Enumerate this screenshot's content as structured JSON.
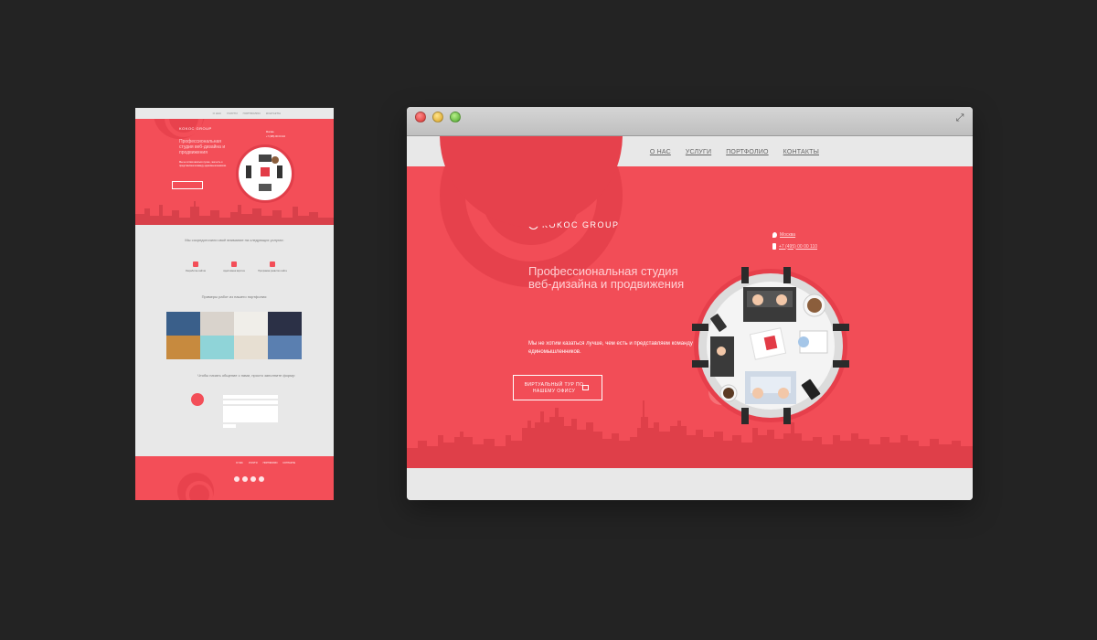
{
  "theme": {
    "accent": "#f24d57",
    "accent_dark": "#e6414c",
    "background": "#232323",
    "site_gray": "#e8e8e8"
  },
  "browser": {
    "window_buttons": [
      "close-icon",
      "minimize-icon",
      "zoom-icon"
    ],
    "fullscreen_icon": "fullscreen-icon"
  },
  "site": {
    "nav": [
      "О НАС",
      "УСЛУГИ",
      "ПОРТФОЛИО",
      "КОНТАКТЫ"
    ],
    "logo_mark": "K",
    "logo_text": "KOKOC GROUP",
    "headline": "Профессиональная студия веб-дизайна и продвижения",
    "subtext": "Мы не хотим казаться лучше, чем есть и представляем команду единомышленников.",
    "cta": "ВИРТУАЛЬНЫЙ ТУР ПО НАШЕМУ ОФИСУ",
    "city": "Москва",
    "phone": "+7 (495) 00 00 110"
  },
  "mini": {
    "nav": [
      "О НАС",
      "УСЛУГИ",
      "ПОРТФОЛИО",
      "КОНТАКТЫ"
    ],
    "logo": "KOKOC GROUP",
    "headline": "Профессиональная студия веб-дизайна и продвижения",
    "sub": "Мы не хотим казаться лучше, чем есть и представляем команду единомышленников.",
    "focus_title": "Мы сосредоточили своё внимание на следующих услугах:",
    "features": [
      "Разработка сайтов",
      "Адаптивная вёрстка",
      "Программа развития сайта"
    ],
    "portfolio_title": "Примеры работ из нашего портфолио:",
    "contact_title": "Чтобы начать общение с нами, просто заполните форму:",
    "footer_nav": [
      "О НАС",
      "УСЛУГИ",
      "ПОРТФОЛИО",
      "КОНТАКТЫ"
    ]
  }
}
